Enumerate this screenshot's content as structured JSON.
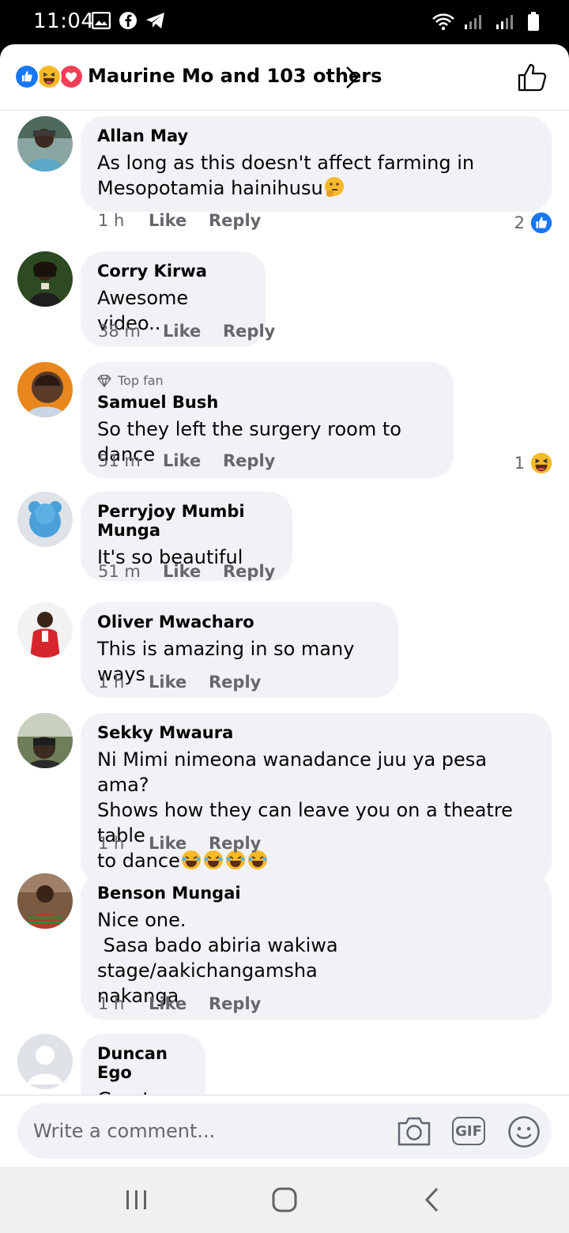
{
  "status_bar": {
    "time": "11:04"
  },
  "header": {
    "reactions_text": "Maurine Mo and 103 others"
  },
  "comments": [
    {
      "author": "Allan May",
      "text": "As long as this doesn't affect farming in\nMesopotamia hainihusu",
      "time": "1 h",
      "like": "Like",
      "reply": "Reply",
      "reaction_count": "2"
    },
    {
      "author": "Corry Kirwa",
      "text": "Awesome video..",
      "time": "38 m",
      "like": "Like",
      "reply": "Reply"
    },
    {
      "badge": "Top fan",
      "author": "Samuel Bush",
      "text": "So they left the surgery room to dance",
      "time": "51 m",
      "like": "Like",
      "reply": "Reply",
      "reaction_count": "1"
    },
    {
      "author": "Perryjoy Mumbi Munga",
      "text": "It's so beautiful",
      "time": "51 m",
      "like": "Like",
      "reply": "Reply"
    },
    {
      "author": "Oliver Mwacharo",
      "text": "This is amazing in so many ways",
      "time": "1 h",
      "like": "Like",
      "reply": "Reply"
    },
    {
      "author": "Sekky Mwaura",
      "text": "Ni Mimi nimeona wanadance juu ya pesa ama?\nShows how they can leave you on a theatre table\nto dance",
      "time": "1 h",
      "like": "Like",
      "reply": "Reply"
    },
    {
      "author": "Benson Mungai",
      "text": "Nice one.\n Sasa bado abiria wakiwa stage/aakichangamsha\nnakanga",
      "time": "1 h",
      "like": "Like",
      "reply": "Reply"
    },
    {
      "author": "Duncan Ego",
      "text": "Great"
    }
  ],
  "composer": {
    "placeholder": "Write a comment...",
    "gif_label": "GIF"
  },
  "colors": {
    "facebook_blue": "#1877f2",
    "bubble_bg": "#f0f2f5",
    "meta_text": "#65676b",
    "love_red": "#f33e58",
    "haha_yellow": "#f7b928"
  },
  "icons": [
    "photo-icon",
    "facebook-icon",
    "telegram-icon",
    "wifi-icon",
    "signal-icon",
    "battery-icon",
    "like-reaction-icon",
    "haha-reaction-icon",
    "love-reaction-icon",
    "chevron-right-icon",
    "thumbs-up-icon",
    "camera-icon",
    "gif-icon",
    "sticker-icon",
    "recents-icon",
    "home-icon",
    "back-icon"
  ]
}
